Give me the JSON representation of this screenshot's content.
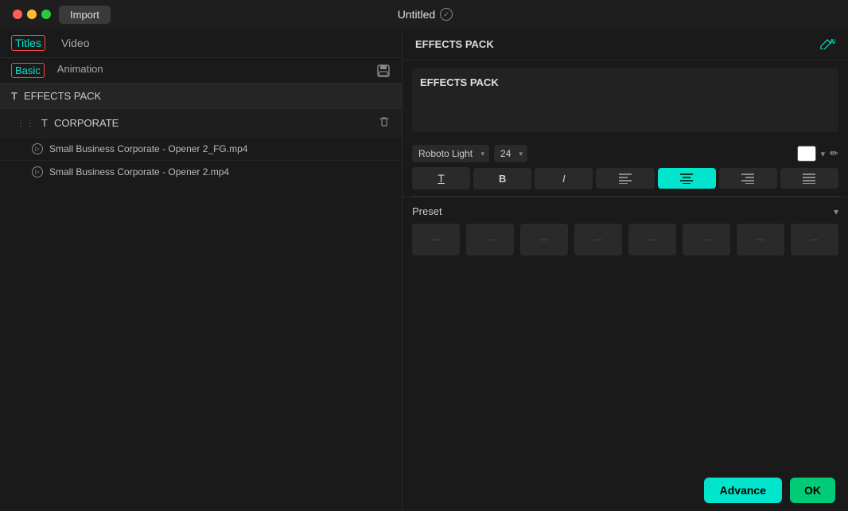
{
  "titlebar": {
    "import_label": "Import",
    "title": "Untitled"
  },
  "tabs": {
    "main": [
      {
        "label": "Titles",
        "active": true
      },
      {
        "label": "Video",
        "active": false
      }
    ],
    "sub": [
      {
        "label": "Basic",
        "active": true
      },
      {
        "label": "Animation",
        "active": false
      }
    ]
  },
  "file_list": {
    "group1": {
      "label": "EFFECTS PACK",
      "subgroups": [
        {
          "label": "CORPORATE",
          "items": [
            {
              "name": "Small Business Corporate - Opener 2_FG.mp4"
            },
            {
              "name": "Small Business Corporate - Opener 2.mp4"
            }
          ]
        }
      ]
    }
  },
  "effects_pack": {
    "title": "EFFECTS PACK",
    "text_content": "EFFECTS PACK"
  },
  "toolbar": {
    "font_name": "Roboto Light",
    "font_size": "24",
    "format_buttons": [
      {
        "label": "T̲",
        "id": "text-style",
        "active": false
      },
      {
        "label": "B",
        "id": "bold",
        "active": false
      },
      {
        "label": "I",
        "id": "italic",
        "active": false
      },
      {
        "label": "≡",
        "id": "align-left",
        "active": false
      },
      {
        "label": "≡",
        "id": "align-center",
        "active": true
      },
      {
        "label": "≡",
        "id": "align-right",
        "active": false
      },
      {
        "label": "≡",
        "id": "align-justify",
        "active": false
      }
    ]
  },
  "preset": {
    "title": "Preset",
    "items": [
      "—",
      "—",
      "—",
      "—",
      "—",
      "—",
      "—",
      "—",
      "—"
    ]
  },
  "bottom_buttons": {
    "advance": "Advance",
    "ok": "OK"
  },
  "icons": {
    "save": "💾",
    "ai": "✏︎AI",
    "trash": "🗑",
    "pencil": "✏"
  }
}
